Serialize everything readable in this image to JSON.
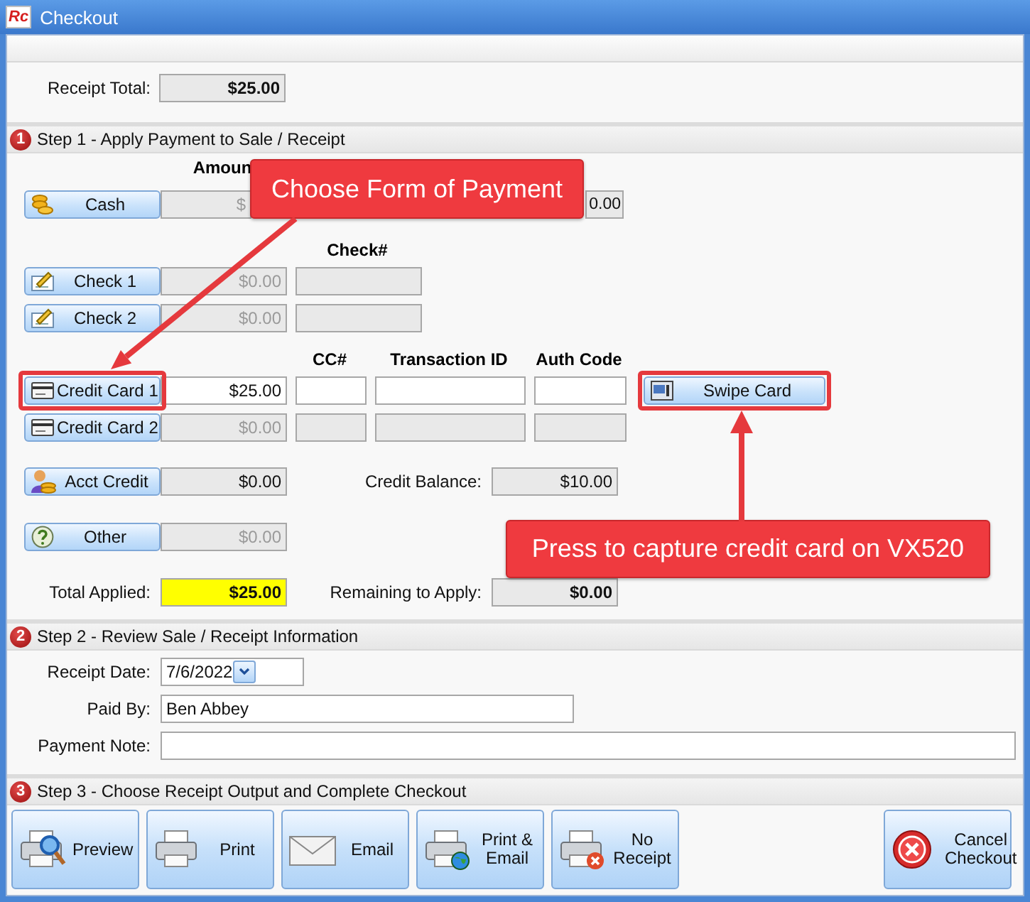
{
  "window": {
    "title": "Checkout",
    "logo": "Rc"
  },
  "receipt_total": {
    "label": "Receipt Total:",
    "value": "$25.00"
  },
  "step1": {
    "number": "1",
    "title": "Step 1 - Apply Payment to Sale / Receipt",
    "headers": {
      "amount": "Amoun",
      "check": "Check#",
      "cc": "CC#",
      "transaction": "Transaction ID",
      "auth": "Auth Code"
    },
    "payments": [
      {
        "kind": "cash",
        "label": "Cash",
        "amount": "$",
        "disabled": true,
        "editable": false,
        "tendered": "0.00"
      },
      {
        "kind": "check",
        "label": "Check 1",
        "amount": "$0.00",
        "disabled": true,
        "editable": false
      },
      {
        "kind": "check",
        "label": "Check 2",
        "amount": "$0.00",
        "disabled": true,
        "editable": false
      },
      {
        "kind": "card",
        "label": "Credit Card 1",
        "amount": "$25.00",
        "disabled": false,
        "editable": true,
        "highlighted": true,
        "swipe": {
          "label": "Swipe Card",
          "highlighted": true
        }
      },
      {
        "kind": "card",
        "label": "Credit Card 2",
        "amount": "$0.00",
        "disabled": true,
        "editable": false
      },
      {
        "kind": "account",
        "label": "Acct Credit",
        "amount": "$0.00",
        "disabled": false,
        "editable": false,
        "balance_label": "Credit Balance:",
        "balance": "$10.00"
      },
      {
        "kind": "other",
        "label": "Other",
        "amount": "$0.00",
        "disabled": true,
        "editable": false
      }
    ],
    "total_applied": {
      "label": "Total Applied:",
      "value": "$25.00",
      "highlighted": true
    },
    "remaining": {
      "label": "Remaining to Apply:",
      "value": "$0.00"
    }
  },
  "step2": {
    "number": "2",
    "title": "Step 2 - Review Sale / Receipt Information",
    "receipt_date": {
      "label": "Receipt Date:",
      "value": "7/6/2022"
    },
    "paid_by": {
      "label": "Paid By:",
      "value": "Ben Abbey"
    },
    "payment_note": {
      "label": "Payment Note:"
    }
  },
  "step3": {
    "number": "3",
    "title": "Step 3 - Choose Receipt Output and Complete Checkout",
    "buttons": [
      {
        "kind": "preview",
        "label": "Preview"
      },
      {
        "kind": "print",
        "label": "Print"
      },
      {
        "kind": "email",
        "label": "Email"
      },
      {
        "kind": "print_email",
        "label": "Print & Email"
      },
      {
        "kind": "no_receipt",
        "label": "No Receipt"
      },
      {
        "kind": "cancel",
        "label": "Cancel Checkout"
      }
    ]
  },
  "callouts": [
    {
      "kind": "payment",
      "text": "Choose Form of Payment"
    },
    {
      "kind": "swipe",
      "text": "Press to capture credit card on VX520"
    }
  ]
}
